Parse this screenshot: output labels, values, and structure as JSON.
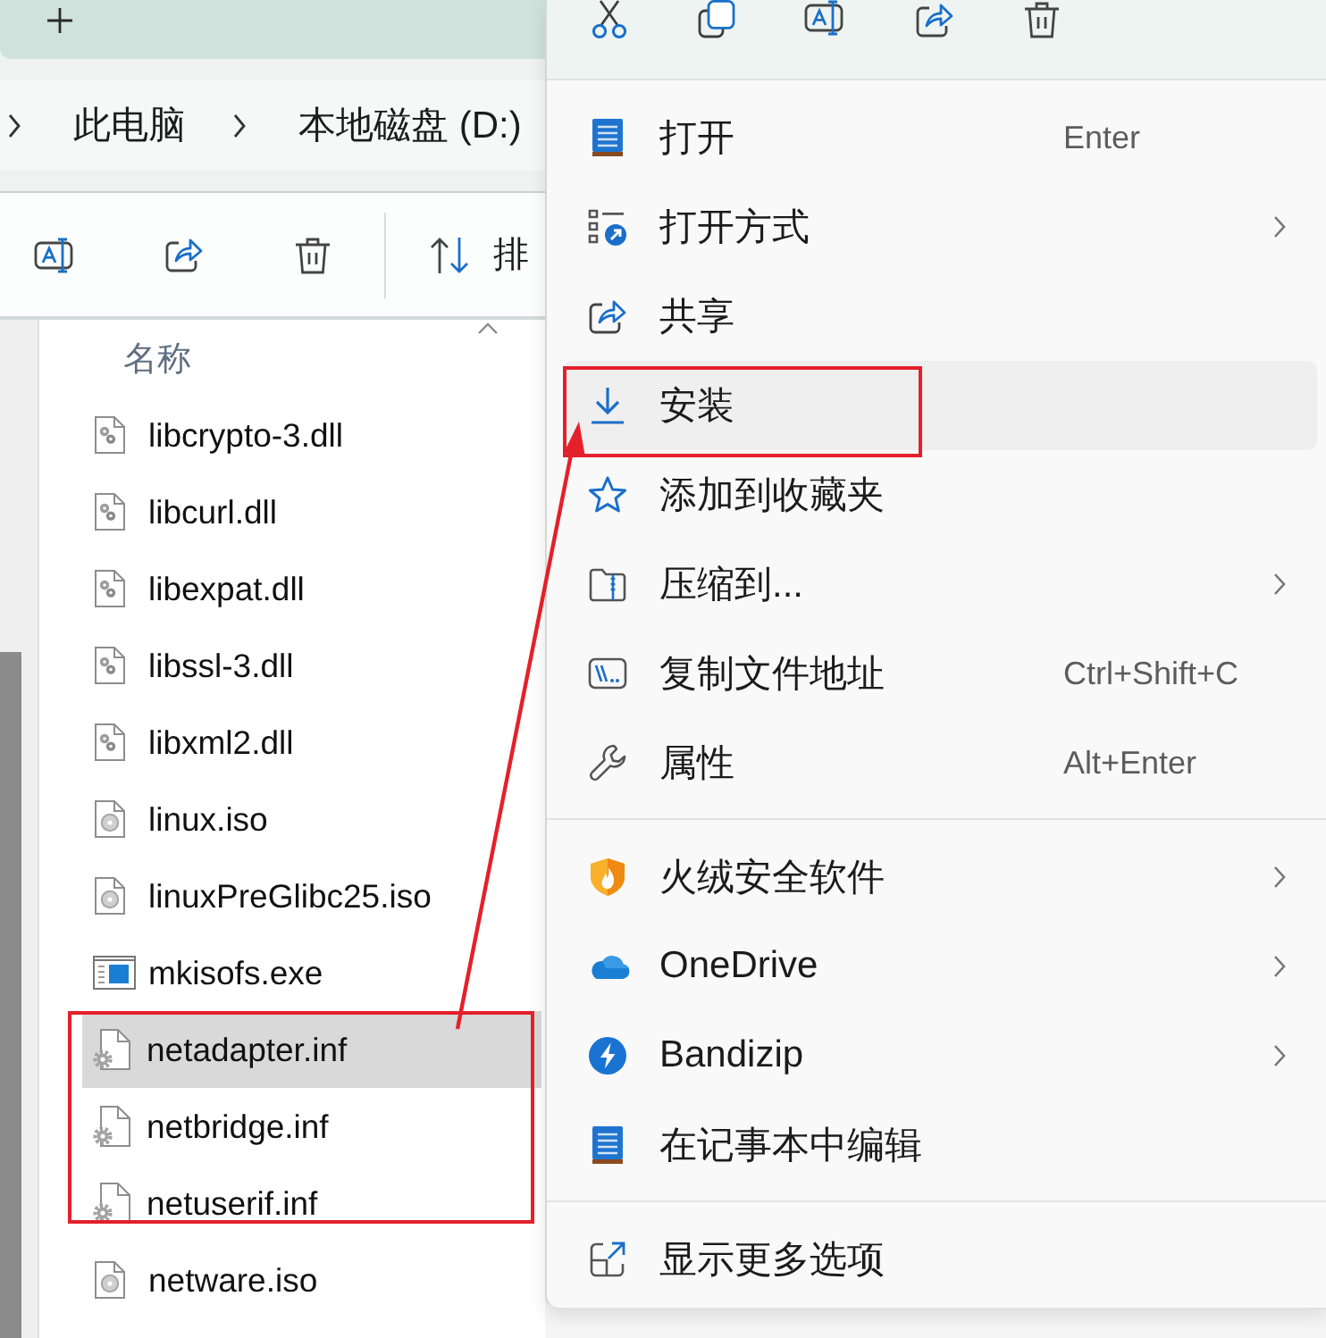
{
  "explorer": {
    "address_bar": {
      "breadcrumbs": [
        "此电脑",
        "本地磁盘 (D:)"
      ]
    },
    "command_bar": {
      "sort_label": "排"
    },
    "file_list": {
      "column_header": "名称",
      "files": [
        {
          "name": "libcrypto-3.dll",
          "kind": "dll",
          "selected": false
        },
        {
          "name": "libcurl.dll",
          "kind": "dll",
          "selected": false
        },
        {
          "name": "libexpat.dll",
          "kind": "dll",
          "selected": false
        },
        {
          "name": "libssl-3.dll",
          "kind": "dll",
          "selected": false
        },
        {
          "name": "libxml2.dll",
          "kind": "dll",
          "selected": false
        },
        {
          "name": "linux.iso",
          "kind": "iso",
          "selected": false
        },
        {
          "name": "linuxPreGlibc25.iso",
          "kind": "iso",
          "selected": false
        },
        {
          "name": "mkisofs.exe",
          "kind": "exe",
          "selected": false
        },
        {
          "name": "netadapter.inf",
          "kind": "inf",
          "selected": true
        },
        {
          "name": "netbridge.inf",
          "kind": "inf",
          "selected": false
        },
        {
          "name": "netuserif.inf",
          "kind": "inf",
          "selected": false
        },
        {
          "name": "netware.iso",
          "kind": "iso",
          "selected": false
        }
      ]
    }
  },
  "context_menu": {
    "sections": [
      [
        {
          "label": "打开",
          "shortcut": "Enter",
          "submenu": false,
          "hovered": false
        },
        {
          "label": "打开方式",
          "submenu": true,
          "hovered": false
        },
        {
          "label": "共享",
          "submenu": false,
          "hovered": false
        },
        {
          "label": "安装",
          "submenu": false,
          "hovered": true
        },
        {
          "label": "添加到收藏夹",
          "submenu": false,
          "hovered": false
        },
        {
          "label": "压缩到...",
          "submenu": true,
          "hovered": false
        },
        {
          "label": "复制文件地址",
          "shortcut": "Ctrl+Shift+C",
          "submenu": false,
          "hovered": false
        },
        {
          "label": "属性",
          "shortcut": "Alt+Enter",
          "submenu": false,
          "hovered": false
        }
      ],
      [
        {
          "label": "火绒安全软件",
          "submenu": true,
          "hovered": false
        },
        {
          "label": "OneDrive",
          "submenu": true,
          "hovered": false
        },
        {
          "label": "Bandizip",
          "submenu": true,
          "hovered": false
        },
        {
          "label": "在记事本中编辑",
          "submenu": false,
          "hovered": false
        }
      ],
      [
        {
          "label": "显示更多选项",
          "submenu": false,
          "hovered": false
        }
      ]
    ]
  }
}
